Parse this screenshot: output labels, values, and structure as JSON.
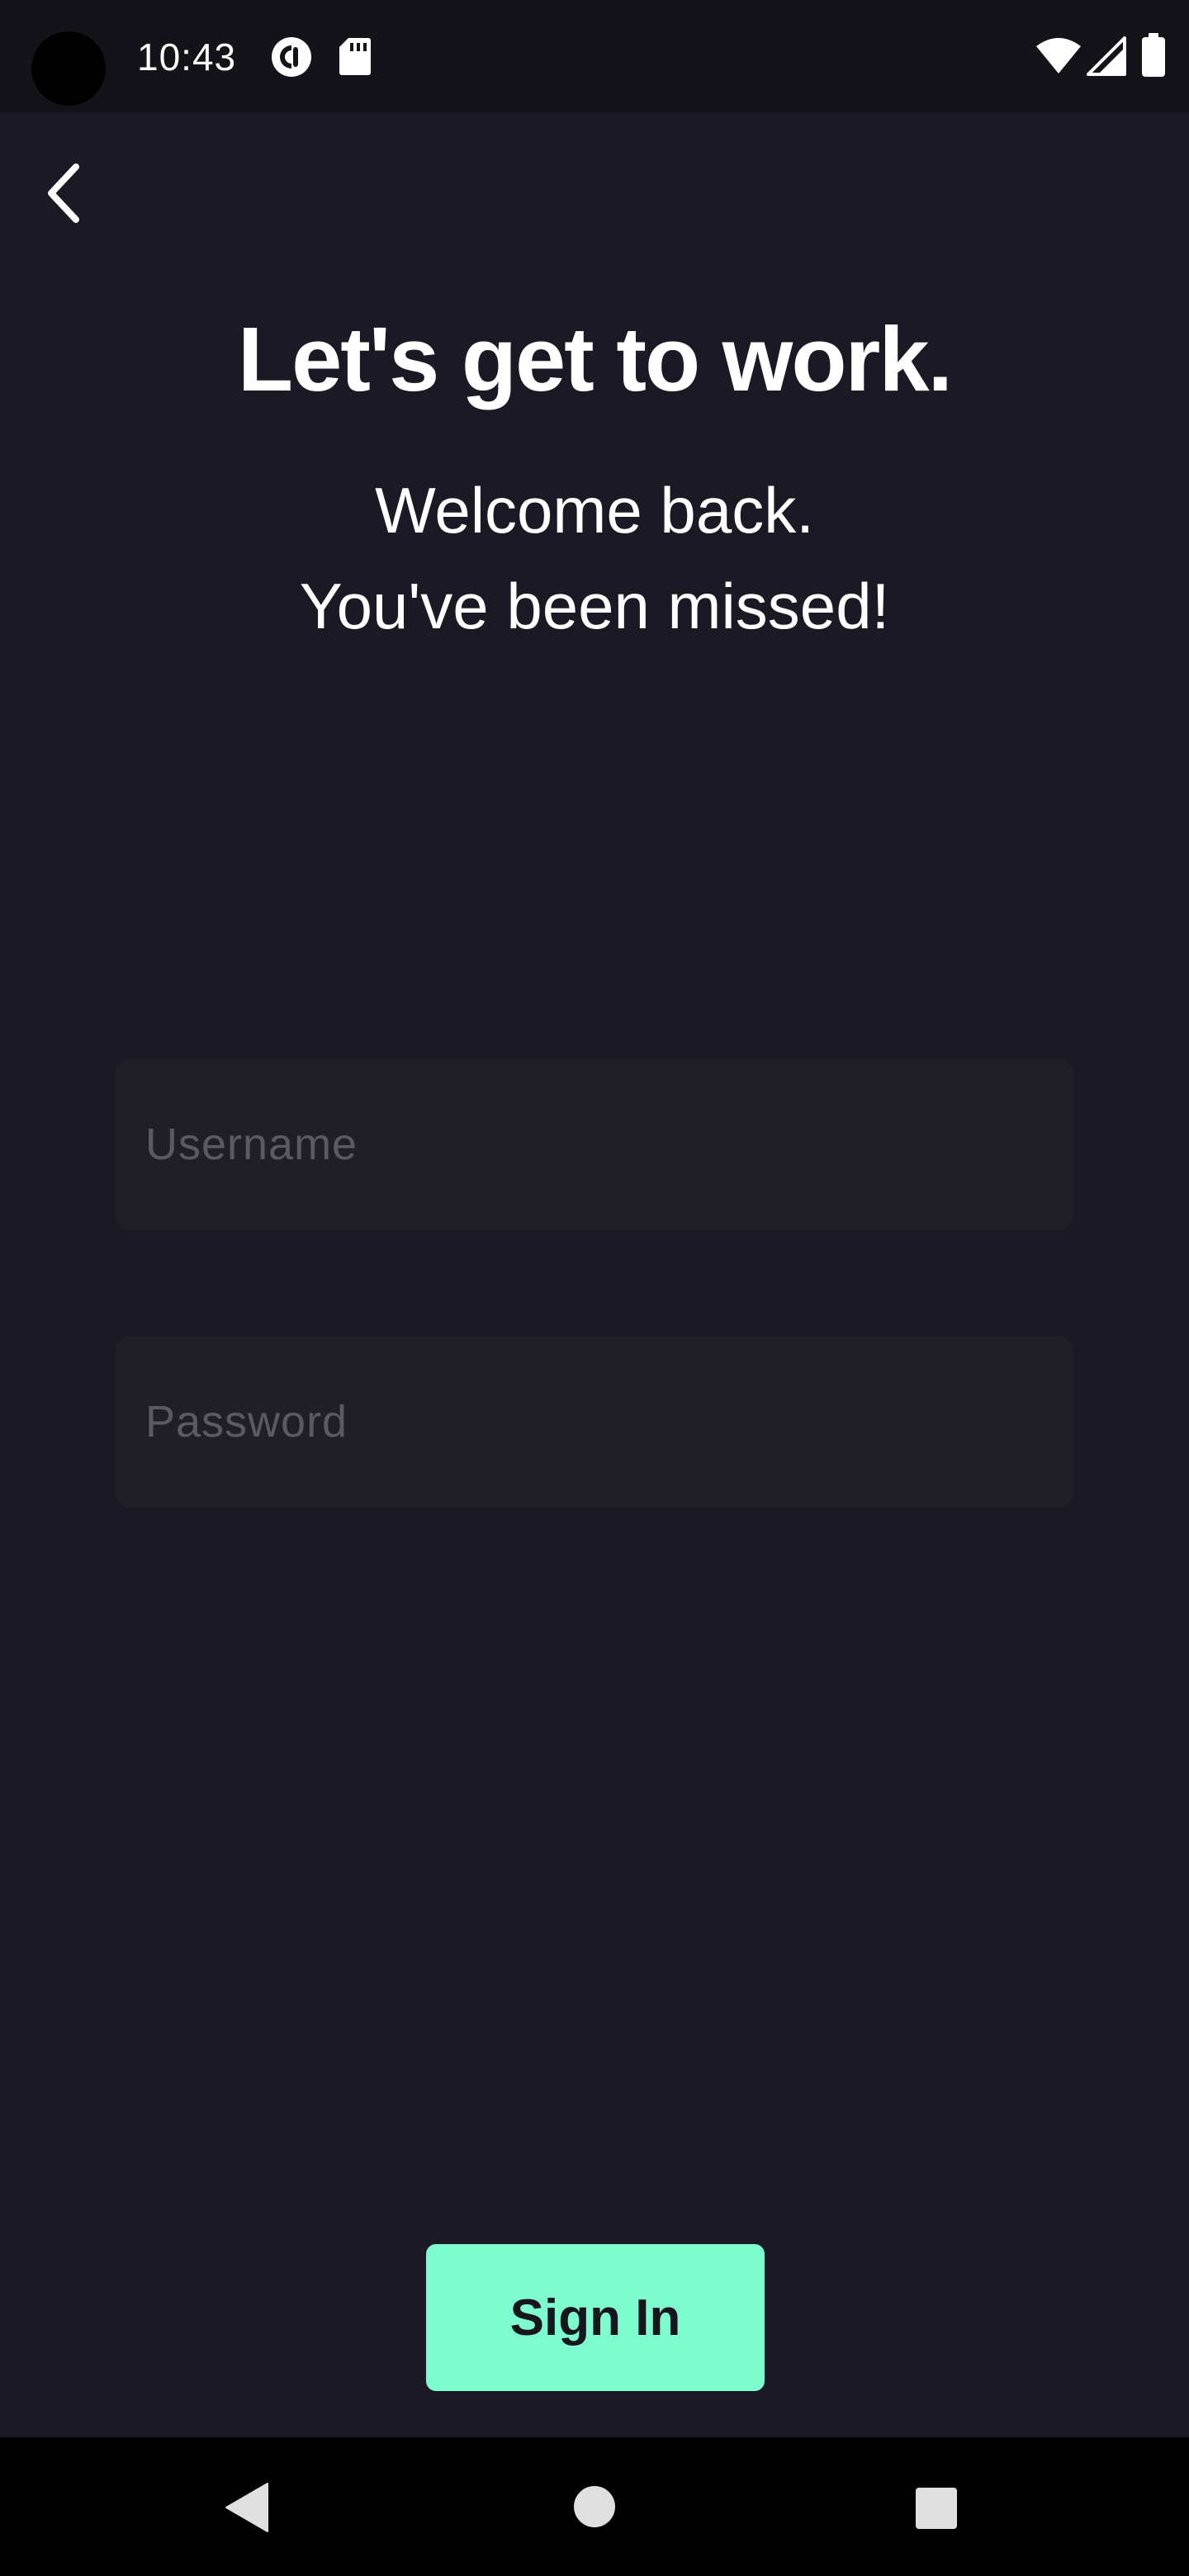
{
  "status_bar": {
    "time": "10:43",
    "icons": [
      "pocketcasts-icon",
      "sd-card-icon",
      "wifi-icon",
      "cell-signal-icon",
      "battery-icon"
    ]
  },
  "header": {
    "back_icon": "chevron-left-icon"
  },
  "main": {
    "title": "Let's get to work.",
    "subtitle_line1": "Welcome back.",
    "subtitle_line2": "You've been missed!"
  },
  "form": {
    "username_placeholder": "Username",
    "username_value": "",
    "password_placeholder": "Password",
    "password_value": "",
    "sign_in_label": "Sign In"
  },
  "nav_bar": {
    "icons": [
      "nav-back-icon",
      "nav-home-icon",
      "nav-recents-icon"
    ]
  },
  "colors": {
    "background": "#1b1a24",
    "input_background": "#201f27",
    "accent": "#7efccf",
    "placeholder": "#5b5a62"
  }
}
